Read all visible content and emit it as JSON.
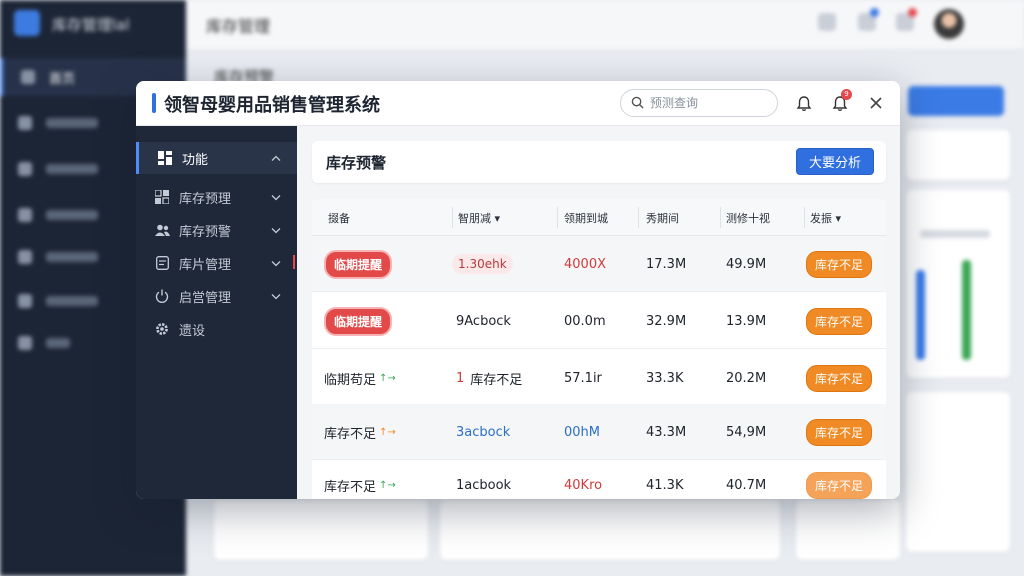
{
  "background": {
    "brand": "库存管理lal",
    "header_title": "库存管理",
    "subtitle": "库存预警",
    "nav_active": "首页"
  },
  "modal": {
    "title": "领智母婴用品销售管理系统",
    "search": {
      "placeholder": "预测查询",
      "value": ""
    },
    "notification_count": "9",
    "icons": {
      "bell": "bell-icon",
      "notification": "bell-badge-icon",
      "close": "close-icon",
      "search": "search-icon"
    }
  },
  "sidebar": {
    "group": {
      "label": "功能",
      "icon": "grid-icon"
    },
    "items": [
      {
        "label": "库存预理",
        "icon": "boxes-icon"
      },
      {
        "label": "库存预警",
        "icon": "users-icon"
      },
      {
        "label": "库片管理",
        "icon": "document-icon"
      },
      {
        "label": "启営管理",
        "icon": "power-icon"
      },
      {
        "label": "遗设",
        "icon": "gear-icon"
      }
    ]
  },
  "content": {
    "title": "库存预警",
    "analyze_button": "大要分析"
  },
  "table": {
    "columns": [
      "掇备",
      "智朋减 ▾",
      "领期到城",
      "秀期间",
      "测修十视",
      "发振 ▾"
    ],
    "rows": [
      {
        "c1": "临期提醒",
        "c1_style": "pill",
        "c2": "1.30ehk",
        "c2_style": "soft",
        "c3": "4000X",
        "c3_color": "#d23b3b",
        "c4": "17.3M",
        "c5": "49.9M",
        "c6": "库存不足"
      },
      {
        "c1": "临期提醒",
        "c1_style": "pill",
        "c2": "9Acbock",
        "c2_style": "plain",
        "c3": "00.0m",
        "c3_color": "#20252d",
        "c4": "32.9M",
        "c5": "13.9M",
        "c6": "库存不足"
      },
      {
        "c1": "临期苟足",
        "c1_style": "text-green",
        "c2_prefix": "1",
        "c2": "库存不足",
        "c2_style": "prefix-red",
        "c3": "57.1ir",
        "c3_color": "#20252d",
        "c4": "33.3K",
        "c5": "20.2M",
        "c6": "库存不足"
      },
      {
        "c1": "库存不足",
        "c1_style": "text-orange",
        "c2": "3acbock",
        "c2_style": "blue",
        "c3": "00hM",
        "c3_color": "#2b6fc4",
        "c4": "43.3M",
        "c5": "54,9M",
        "c6": "库存不足"
      },
      {
        "c1": "库存不足",
        "c1_style": "text-green",
        "c2": "1acbook",
        "c2_style": "plain",
        "c3": "40Kro",
        "c3_color": "#d23b3b",
        "c4": "41.3K",
        "c5": "40.7M",
        "c6": "库存不足"
      }
    ]
  },
  "colors": {
    "accent": "#2f6fe0",
    "alert_red": "#e24a4a",
    "warn_orange": "#f08a24",
    "sidebar": "#1f2838"
  }
}
